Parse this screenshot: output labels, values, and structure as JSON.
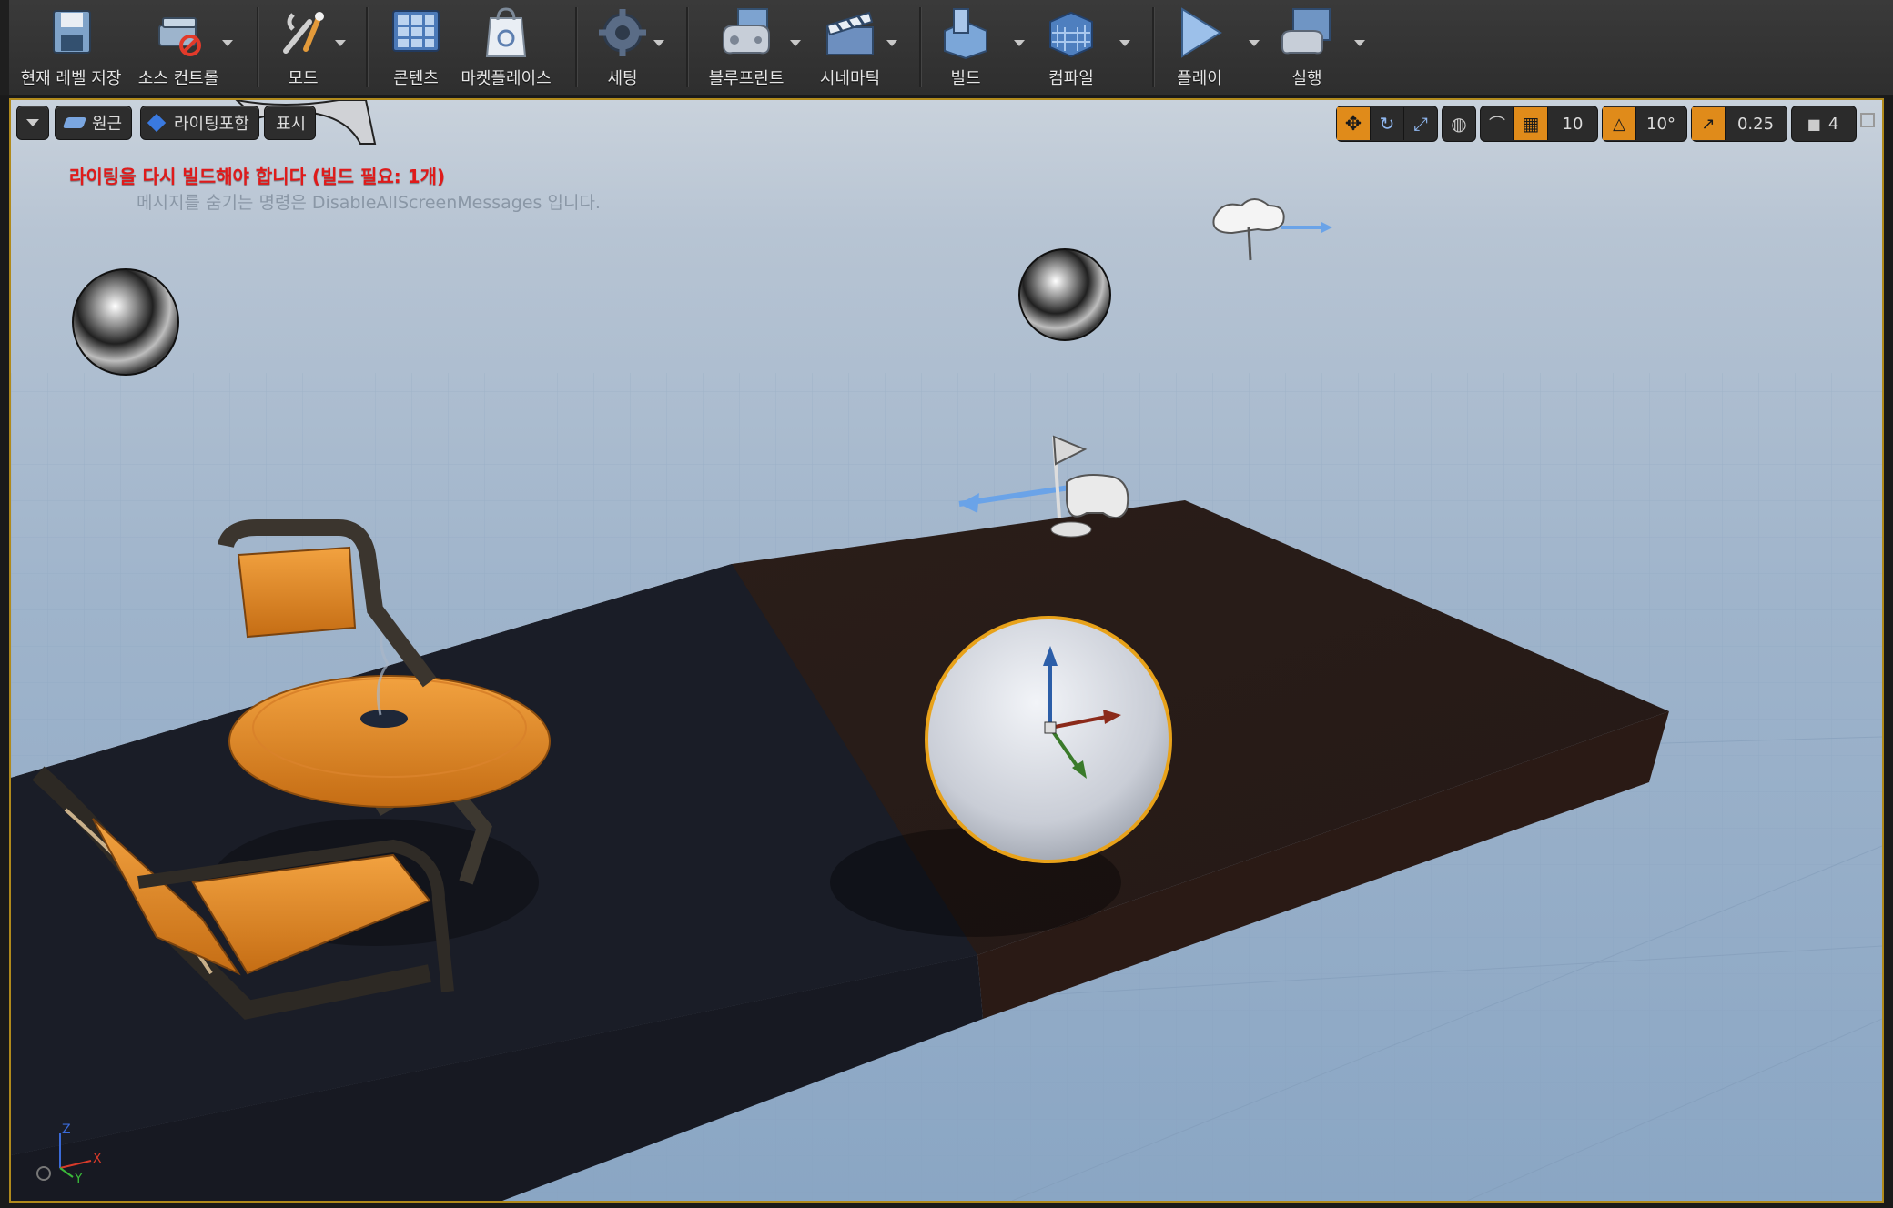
{
  "toolbar": {
    "items": [
      {
        "label": "현재 레벨 저장",
        "icon": "save-icon"
      },
      {
        "label": "소스 컨트롤",
        "icon": "source-control-icon"
      },
      {
        "label": "모드",
        "icon": "modes-icon"
      },
      {
        "label": "콘텐츠",
        "icon": "content-icon"
      },
      {
        "label": "마켓플레이스",
        "icon": "marketplace-icon"
      },
      {
        "label": "세팅",
        "icon": "settings-icon"
      },
      {
        "label": "블루프린트",
        "icon": "blueprint-icon"
      },
      {
        "label": "시네마틱",
        "icon": "cinematic-icon"
      },
      {
        "label": "빌드",
        "icon": "build-icon"
      },
      {
        "label": "컴파일",
        "icon": "compile-icon"
      },
      {
        "label": "플레이",
        "icon": "play-icon"
      },
      {
        "label": "실행",
        "icon": "launch-icon"
      }
    ]
  },
  "viewport": {
    "view_mode": "원근",
    "lighting_mode": "라이팅포함",
    "show_label": "표시",
    "grid_snap": "10",
    "rotation_snap": "10°",
    "scale_snap": "0.25",
    "camera_speed": "4",
    "messages": {
      "error": "라이팅을 다시 빌드해야 합니다 (빌드 필요: 1개)",
      "hint": "메시지를 숨기는 명령은 DisableAllScreenMessages 입니다."
    },
    "axis_labels": {
      "z": "Z",
      "x": "X",
      "y": "Y"
    }
  },
  "colors": {
    "accent": "#e08b1a",
    "error": "#e01a1a",
    "selection": "#e8a21a"
  }
}
